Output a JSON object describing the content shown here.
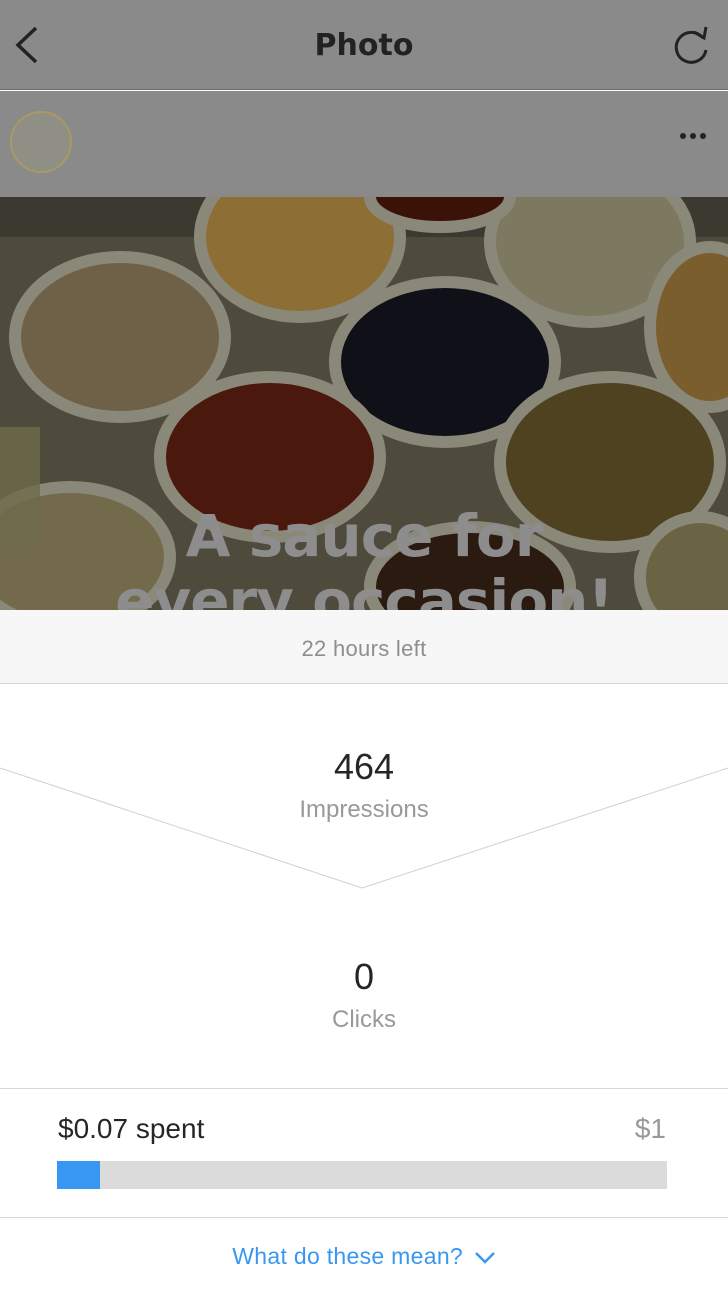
{
  "nav": {
    "title": "Photo",
    "back_icon": "chevron-left-icon",
    "refresh_icon": "refresh-icon"
  },
  "post": {
    "more_icon": "more-horizontal-icon",
    "overlay_text": [
      "A sauce for",
      "every occasion!"
    ]
  },
  "promotion": {
    "time_left": "22 hours left",
    "metrics": [
      {
        "value": "464",
        "label": "Impressions"
      },
      {
        "value": "0",
        "label": "Clicks"
      }
    ],
    "spent_label": "$0.07 spent",
    "budget_label": "$1",
    "spent_fraction": 0.07,
    "help_link": "What do these mean?",
    "help_icon": "chevron-down-icon"
  },
  "colors": {
    "accent": "#3897f0",
    "progress_track": "#dbdbdb",
    "dim_overlay": "#8a8a8a"
  }
}
